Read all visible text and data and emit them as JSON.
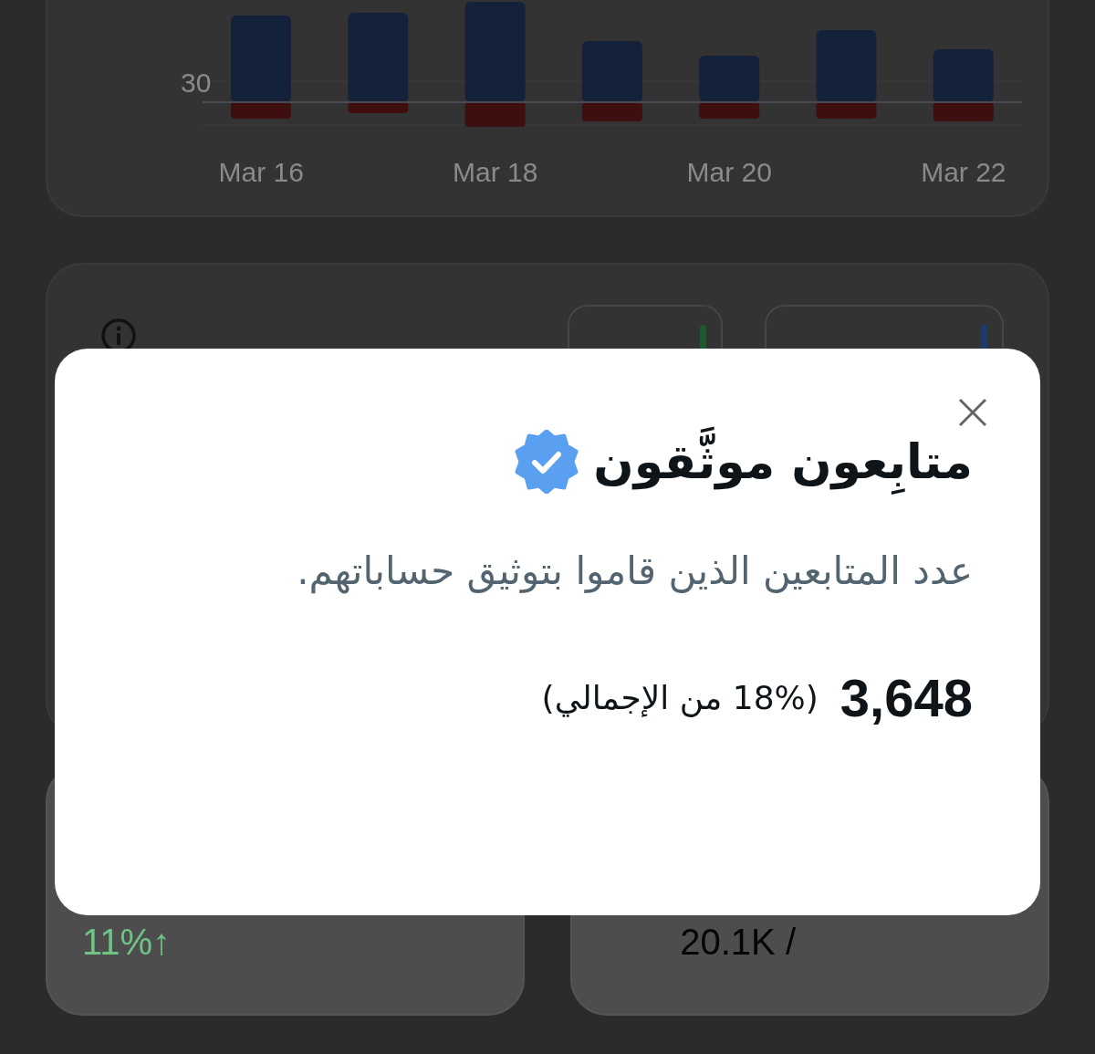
{
  "chart_card": {
    "y_tick": "30",
    "x_labels": [
      "Mar 16",
      "Mar 18",
      "Mar 20",
      "Mar 22"
    ]
  },
  "metrics_card": {
    "tabs": [
      {
        "color": "#1c3a6e"
      },
      {
        "color": "#1d5a2f"
      }
    ]
  },
  "stat_cards": [
    {
      "change": "11%↑",
      "kind": "change"
    },
    {
      "total": "20.1K /",
      "kind": "total"
    }
  ],
  "dialog": {
    "title": "متابِعون موثَّقون",
    "description": "عدد المتابعين الذين قاموا بتوثيق حساباتهم.",
    "count": "3,648",
    "share": "(18% من الإجمالي)"
  }
}
